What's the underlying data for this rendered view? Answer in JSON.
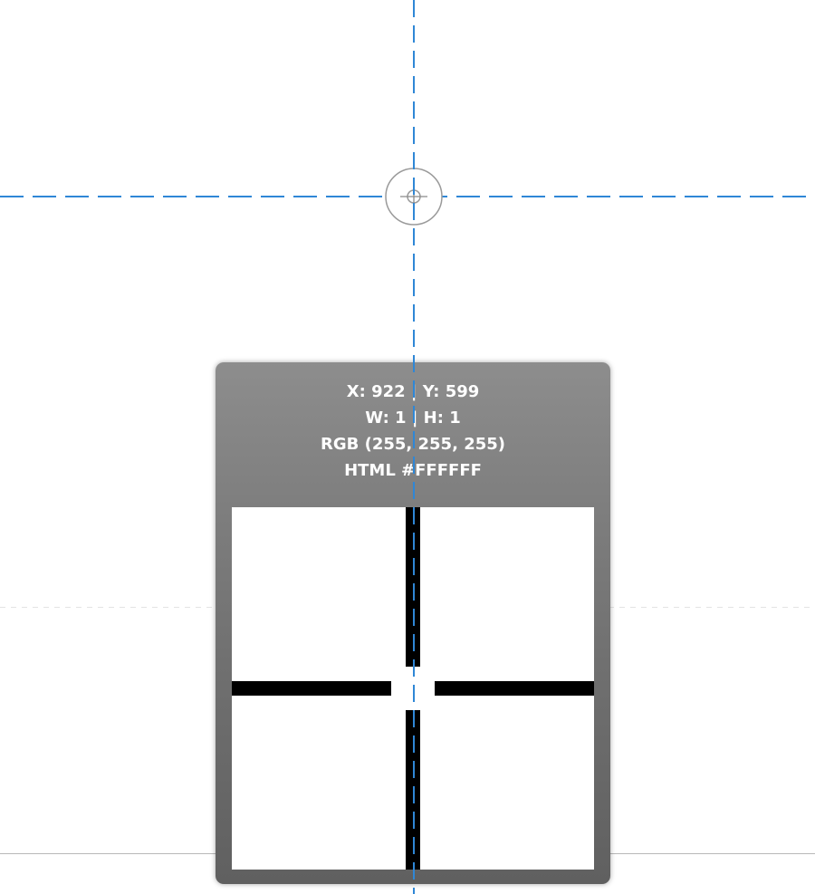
{
  "colors": {
    "guide": "#2f87d6",
    "panel_top": "#8d8d8d",
    "panel_bottom": "#606060",
    "sampled_pixel": "#FFFFFF",
    "panel_text": "#ffffff"
  },
  "cursor": {
    "icon": "crosshair-target-icon"
  },
  "magnifier": {
    "position_line": "X: 922 | Y: 599",
    "size_line": "W: 1 | H: 1",
    "rgb_line": "RGB (255, 255, 255)",
    "html_line": "HTML #FFFFFF",
    "zoom_icon": "crosshair-zoom-icon"
  }
}
